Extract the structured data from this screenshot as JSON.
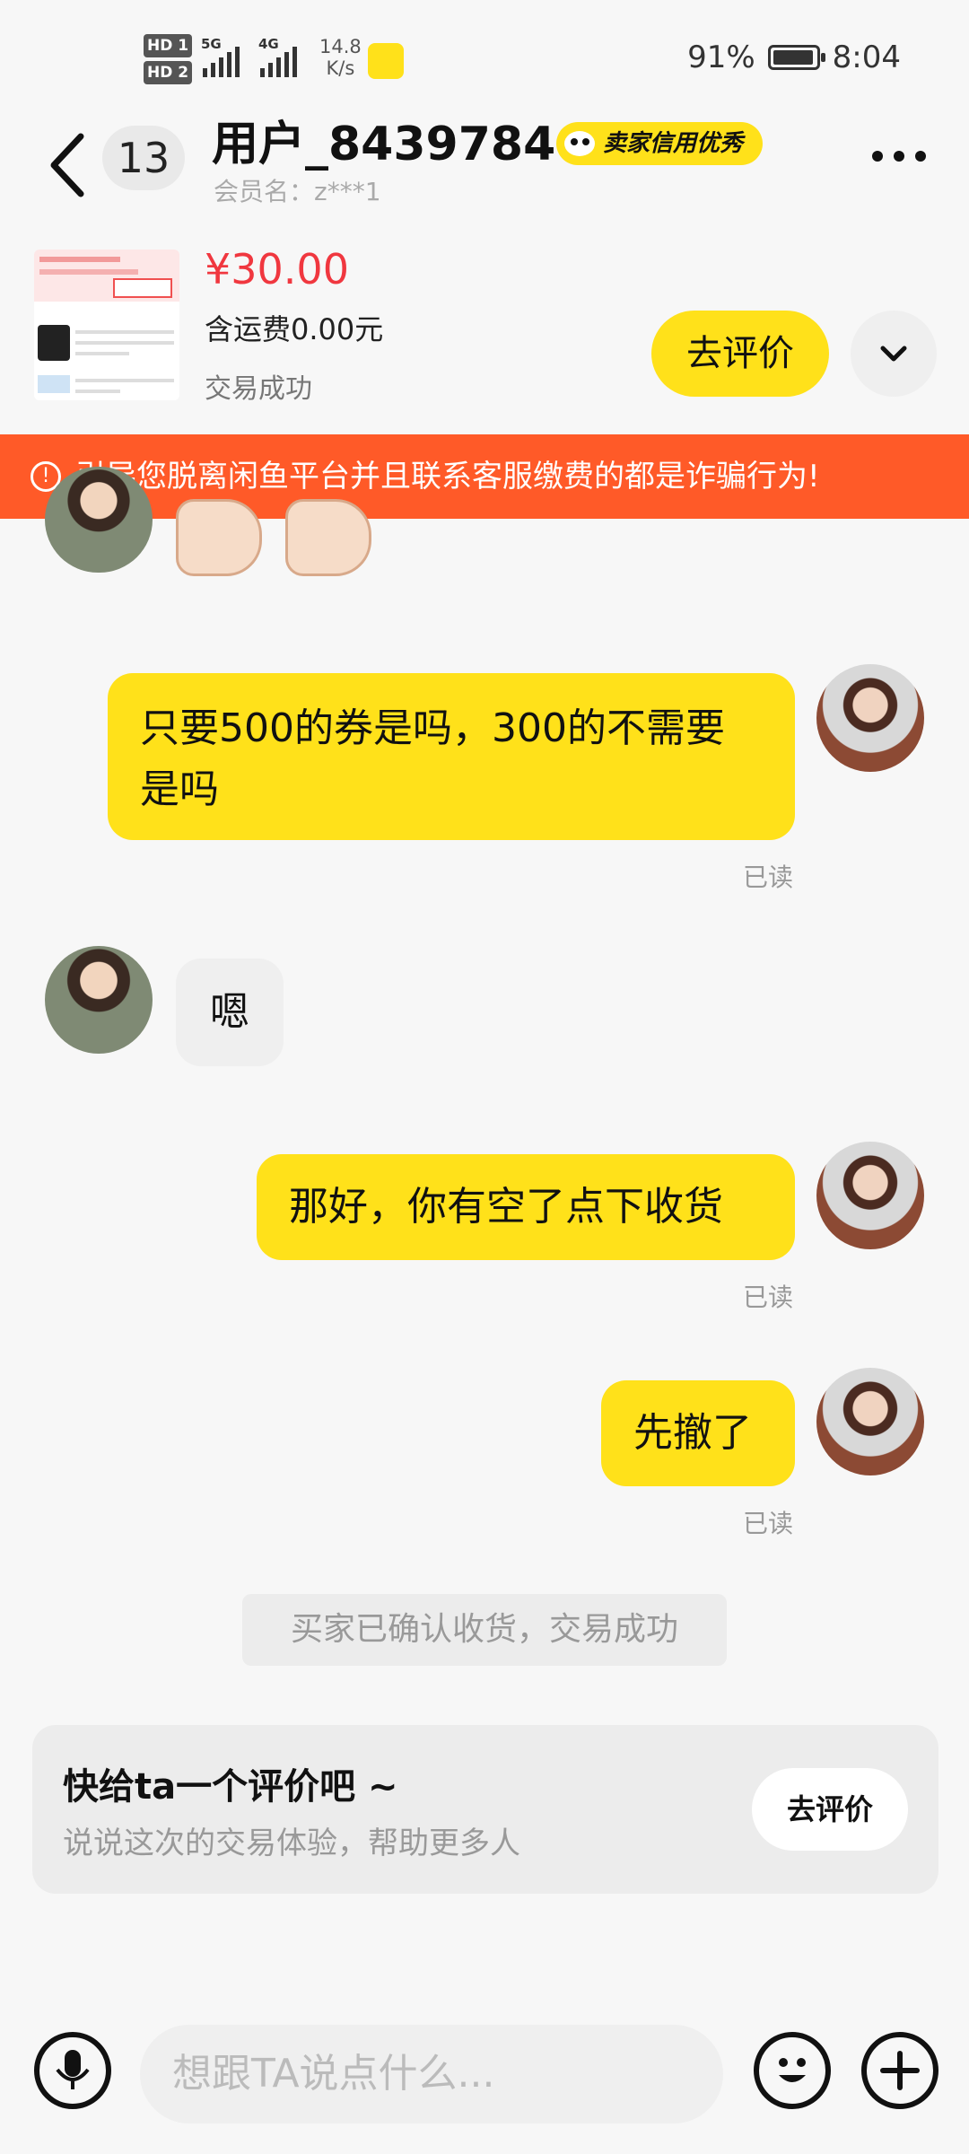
{
  "status_bar": {
    "hd1": "HD 1",
    "hd2": "HD 2",
    "sig1_label": "5G",
    "sig2_label": "4G",
    "net_speed_value": "14.8",
    "net_speed_unit": "K/s",
    "battery": "91%",
    "time": "8:04"
  },
  "header": {
    "unread_count": "13",
    "user_name": "用户_84397840",
    "credit_badge": "卖家信用优秀",
    "member_label": "会员名：z***1"
  },
  "product": {
    "price": "¥30.00",
    "shipping": "含运费0.00元",
    "status": "交易成功",
    "rate_button": "去评价"
  },
  "warning": {
    "text": "引导您脱离闲鱼平台并且联系客服缴费的都是诈骗行为!"
  },
  "messages": [
    {
      "from": "buyer",
      "content": "thumbs-up x2"
    },
    {
      "from": "me",
      "text": "只要500的券是吗，300的不需要是吗",
      "read": "已读"
    },
    {
      "from": "buyer",
      "text": "嗯"
    },
    {
      "from": "me",
      "text": "那好，你有空了点下收货",
      "read": "已读"
    },
    {
      "from": "me",
      "text": "先撤了",
      "read": "已读"
    }
  ],
  "system_notice": "买家已确认收货，交易成功",
  "review_card": {
    "title": "快给ta一个评价吧 ~",
    "subtitle": "说说这次的交易体验，帮助更多人",
    "button": "去评价"
  },
  "input_bar": {
    "placeholder": "想跟TA说点什么..."
  },
  "colors": {
    "accent_yellow": "#ffe11a",
    "warning_orange": "#ff5a28",
    "price_red": "#f0373f"
  }
}
